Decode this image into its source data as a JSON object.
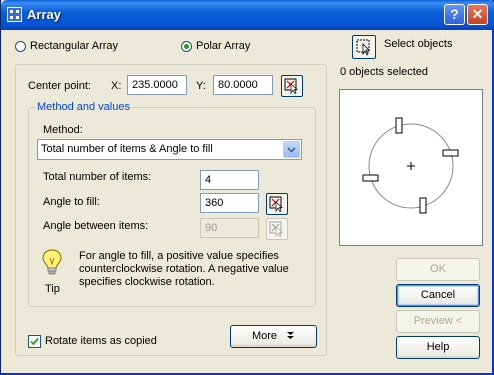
{
  "window": {
    "title": "Array",
    "help_button": "?",
    "close_button": "✕"
  },
  "array_type": {
    "rectangular_label": "Rectangular Array",
    "polar_label": "Polar Array",
    "selected": "Polar Array"
  },
  "select_objects": {
    "label": "Select objects",
    "status": "0 objects selected"
  },
  "center_point": {
    "label": "Center point:",
    "x_label": "X:",
    "x_value": "235.0000",
    "y_label": "Y:",
    "y_value": "80.0000"
  },
  "method_group": {
    "title": "Method and values",
    "method_label": "Method:",
    "method_value": "Total number of items & Angle to fill",
    "total_items_label": "Total number of items:",
    "total_items_value": "4",
    "angle_fill_label": "Angle to fill:",
    "angle_fill_value": "360",
    "angle_between_label": "Angle between items:",
    "angle_between_value": "90"
  },
  "tip": {
    "label": "Tip",
    "line1": "For angle to fill, a positive value specifies",
    "line2": "counterclockwise rotation.  A negative value",
    "line3": "specifies clockwise rotation."
  },
  "rotate_items": {
    "label": "Rotate items as copied",
    "checked": true
  },
  "buttons": {
    "more": "More",
    "ok": "OK",
    "cancel": "Cancel",
    "preview": "Preview <",
    "help": "Help"
  },
  "colors": {
    "title_bar": "#0a5fd8",
    "group_title": "#0046d5",
    "radio_dot": "#21a121",
    "dialog_bg": "#ece9d8"
  }
}
